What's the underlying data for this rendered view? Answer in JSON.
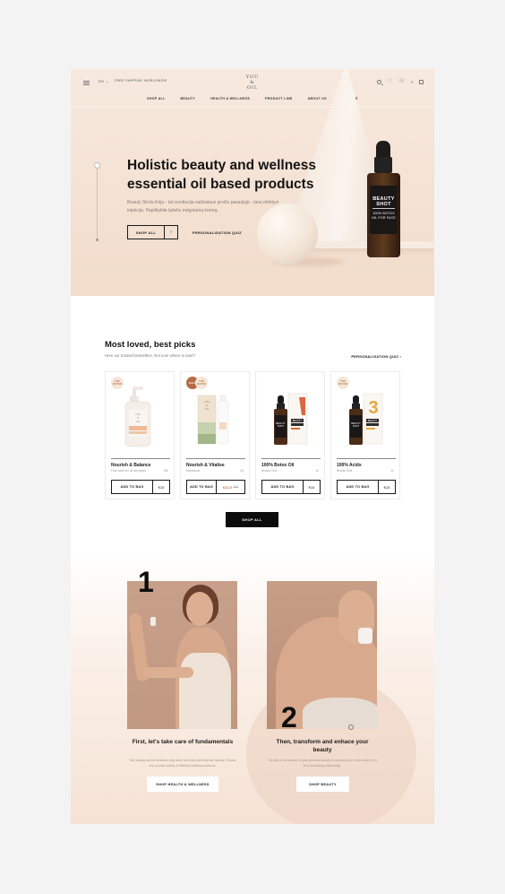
{
  "header": {
    "lang": "EN",
    "shipping": "FREE SHIPPING WORLDWIDE",
    "logo_lines": [
      "YOU",
      "&",
      "OIL"
    ],
    "cart_count": "0",
    "nav": [
      "SHOP ALL",
      "BEAUTY",
      "HEALTH & WELLNESS",
      "PRODUCT LINE",
      "ABOUT US",
      "SCIENCE"
    ]
  },
  "hero": {
    "title": "Holistic beauty and wellness essential oil based products",
    "description": "Beauty Shots linija - tai revoliucija natūralaus grožio pasaulyje - tarsi efektyvi injekcija. Papildykite lašeliu mėgstamą kremą.",
    "shop_button": "SHOP ALL",
    "shop_arrow": "›",
    "quiz_link": "PERSONALISATION QUIZ",
    "bottle_label_title": "BEAUTY SHOT",
    "bottle_label_sub": "100% BOTOX OIL FOR FACE"
  },
  "best_picks": {
    "title": "Most loved, best picks",
    "subtitle": "Here our trusted bestsellers. Not sure where to start?",
    "quiz_link": "PERSONALISATION QUIZ",
    "quiz_arrow": "›",
    "products": [
      {
        "badges": [
          "TOP RATED"
        ],
        "name": "Nourish & Balance",
        "desc": "Face wash for all skin types",
        "size": "250",
        "add": "ADD TO BAG",
        "price": "€15",
        "old_price": ""
      },
      {
        "badges": [
          "SALE",
          "TOP RATED"
        ],
        "name": "Nourish & Vitalise",
        "desc": "Moisturiser",
        "size": "50",
        "add": "ADD TO BAG",
        "price": "€11,5",
        "old_price": "€15"
      },
      {
        "badges": [],
        "name": "100% Botox Oil",
        "desc": "Beauty Shot",
        "size": "10",
        "add": "ADD TO BAG",
        "price": "€15",
        "old_price": ""
      },
      {
        "badges": [
          "TOP RATED"
        ],
        "name": "100% Acids",
        "desc": "Beauty Shot",
        "size": "10",
        "add": "ADD TO BAG",
        "price": "€15",
        "old_price": ""
      }
    ],
    "shop_all": "SHOP ALL"
  },
  "steps": [
    {
      "number": "1",
      "title": "First, let's take care of fundamentals",
      "desc": "True beauty can be achieved only when the body and mind are healthy. Choose from a wide variety of effective wellness products.",
      "button": "SHOP HEALTH & WELLNESS"
    },
    {
      "number": "2",
      "title": "Then, transform and enhace your beauty",
      "desc": "The skin is the surface of your personal planet. It connects you to the world. Let it be a nourishing relationship.",
      "button": "SHOP BEAUTY"
    }
  ],
  "colors": {
    "hero_bg": "#f2dccb",
    "accent": "#c0713f",
    "sale_badge": "#b86a46",
    "top_badge": "#f5e6d8",
    "dark": "#0c0c0c"
  },
  "icons": [
    "menu-icon",
    "search-icon",
    "heart-icon",
    "user-icon",
    "bag-icon"
  ]
}
